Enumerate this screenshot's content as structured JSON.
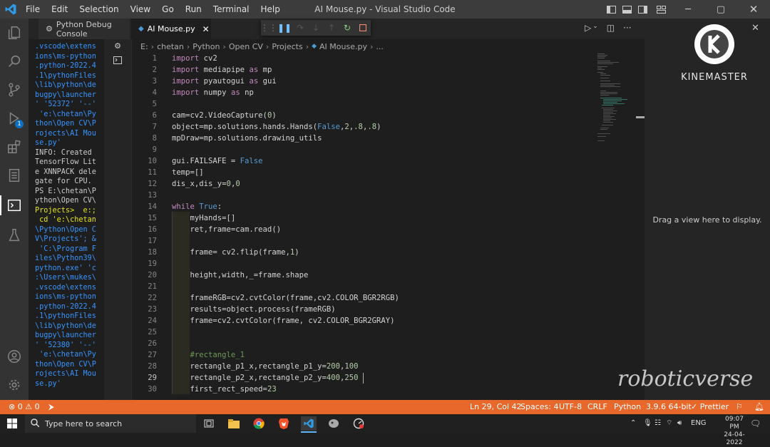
{
  "window": {
    "title": "AI Mouse.py - Visual Studio Code",
    "minimize": "─",
    "maximize": "▢",
    "close": "✕"
  },
  "menu": [
    "File",
    "Edit",
    "Selection",
    "View",
    "Go",
    "Run",
    "Terminal",
    "Help"
  ],
  "tabs": [
    {
      "label": "Python Debug Console",
      "icon": "gear-icon"
    },
    {
      "label": "AI Mouse.py",
      "icon": "python-file-icon",
      "close": "✕"
    }
  ],
  "debug_toolbar": [
    "drag-handle-icon",
    "pause-icon",
    "step-over-icon",
    "step-into-icon",
    "step-out-icon",
    "restart-icon",
    "stop-icon"
  ],
  "breadcrumb": [
    "E:",
    "chetan",
    "Python",
    "Open CV",
    "Projects",
    "AI Mouse.py",
    "..."
  ],
  "terminal": {
    "lines": [
      {
        "t": ".vscode\\extens",
        "c": "b"
      },
      {
        "t": "ions\\ms-python",
        "c": "b"
      },
      {
        "t": ".python-2022.4",
        "c": "b"
      },
      {
        "t": ".1\\pythonFiles",
        "c": "b"
      },
      {
        "t": "\\lib\\python\\de",
        "c": "b"
      },
      {
        "t": "bugpy\\launcher",
        "c": "b"
      },
      {
        "t": "' '52372' '--'",
        "c": "b"
      },
      {
        "t": " 'e:\\chetan\\Py",
        "c": "b"
      },
      {
        "t": "thon\\Open CV\\P",
        "c": "b"
      },
      {
        "t": "rojects\\AI Mou",
        "c": "b"
      },
      {
        "t": "se.py'",
        "c": "b"
      },
      {
        "t": "INFO: Created",
        "c": "w"
      },
      {
        "t": "TensorFlow Lit",
        "c": "w"
      },
      {
        "t": "e XNNPACK dele",
        "c": "w"
      },
      {
        "t": "gate for CPU.",
        "c": "w"
      },
      {
        "t": "PS E:\\chetan\\P",
        "c": "w"
      },
      {
        "t": "ython\\Open CV\\",
        "c": "w"
      },
      {
        "t": "Projects>  e:;",
        "c": "y"
      },
      {
        "t": " cd 'e:\\chetan",
        "c": "y"
      },
      {
        "t": "\\Python\\Open C",
        "c": "b"
      },
      {
        "t": "V\\Projects'; &",
        "c": "b"
      },
      {
        "t": " 'C:\\Program F",
        "c": "b"
      },
      {
        "t": "iles\\Python39\\",
        "c": "b"
      },
      {
        "t": "python.exe' 'c",
        "c": "b"
      },
      {
        "t": ":\\Users\\mukes\\",
        "c": "b"
      },
      {
        "t": ".vscode\\extens",
        "c": "b"
      },
      {
        "t": "ions\\ms-python",
        "c": "b"
      },
      {
        "t": ".python-2022.4",
        "c": "b"
      },
      {
        "t": ".1\\pythonFiles",
        "c": "b"
      },
      {
        "t": "\\lib\\python\\de",
        "c": "b"
      },
      {
        "t": "bugpy\\launcher",
        "c": "b"
      },
      {
        "t": "' '52380' '--'",
        "c": "b"
      },
      {
        "t": " 'e:\\chetan\\Py",
        "c": "b"
      },
      {
        "t": "thon\\Open CV\\P",
        "c": "b"
      },
      {
        "t": "rojects\\AI Mou",
        "c": "b"
      },
      {
        "t": "se.py'",
        "c": "b"
      }
    ]
  },
  "code": {
    "current_line": 29,
    "lines": [
      {
        "n": "1",
        "html": "<span class='kw'>import</span> cv2"
      },
      {
        "n": "2",
        "html": "<span class='kw'>import</span> mediapipe <span class='kw'>as</span> mp"
      },
      {
        "n": "3",
        "html": "<span class='kw'>import</span> pyautogui <span class='kw'>as</span> gui"
      },
      {
        "n": "4",
        "html": "<span class='kw'>import</span> numpy <span class='kw'>as</span> np"
      },
      {
        "n": "5",
        "html": ""
      },
      {
        "n": "6",
        "html": "cam=cv2.VideoCapture(<span class='nm'>0</span>)"
      },
      {
        "n": "7",
        "html": "object=mp.solutions.hands.Hands(<span class='kb'>False</span>,<span class='nm'>2</span>,<span class='nm'>.8</span>,<span class='nm'>.8</span>)"
      },
      {
        "n": "8",
        "html": "mpDraw=mp.solutions.drawing_utils"
      },
      {
        "n": "9",
        "html": ""
      },
      {
        "n": "10",
        "html": "gui.FAILSAFE = <span class='kb'>False</span>"
      },
      {
        "n": "11",
        "html": "temp=[]"
      },
      {
        "n": "12",
        "html": "dis_x,dis_y=<span class='nm'>0</span>,<span class='nm'>0</span>"
      },
      {
        "n": "13",
        "html": ""
      },
      {
        "n": "14",
        "html": "<span class='kw'>while</span> <span class='kb'>True</span>:"
      },
      {
        "n": "15",
        "html": "    myHands=[]"
      },
      {
        "n": "16",
        "html": "    ret,frame=cam.read()"
      },
      {
        "n": "17",
        "html": ""
      },
      {
        "n": "18",
        "html": "    frame= cv2.flip(frame,<span class='nm'>1</span>)"
      },
      {
        "n": "19",
        "html": ""
      },
      {
        "n": "20",
        "html": "    height,width,_=frame.shape"
      },
      {
        "n": "21",
        "html": ""
      },
      {
        "n": "22",
        "html": "    frameRGB=cv2.cvtColor(frame,cv2.COLOR_BGR2RGB)"
      },
      {
        "n": "23",
        "html": "    results=object.process(frameRGB)"
      },
      {
        "n": "24",
        "html": "    frame=cv2.cvtColor(frame, cv2.COLOR_BGR2GRAY)"
      },
      {
        "n": "25",
        "html": ""
      },
      {
        "n": "26",
        "html": ""
      },
      {
        "n": "27",
        "html": "    <span class='cm'>#rectangle_1</span>"
      },
      {
        "n": "28",
        "html": "    rectangle_p1_x,rectangle_p1_y=<span class='nm'>200</span>,<span class='nm'>100</span>"
      },
      {
        "n": "29",
        "html": "    rectangle_p2_x,rectangle_p2_y=<span class='nm'>400</span>,<span class='nm'>250</span>"
      },
      {
        "n": "30",
        "html": "    first_rect_speed=<span class='nm'>23</span>"
      }
    ]
  },
  "right_panel": {
    "logo_text": "KINEMASTER",
    "drag_text": "Drag a view here to display.",
    "close": "✕"
  },
  "watermark": "roboticverse",
  "status": {
    "errors": "0",
    "warnings": "0",
    "position": "Ln 29, Col 42",
    "spaces": "Spaces: 4",
    "encoding": "UTF-8",
    "eol": "CRLF",
    "language": "Python",
    "interpreter": "3.9.6 64-bit",
    "formatter": "Prettier"
  },
  "taskbar": {
    "search_placeholder": "Type here to search",
    "lang": "ENG",
    "time": "09:07 PM",
    "date": "24-04-2022"
  },
  "colors": {
    "status_bar": "#e8682b",
    "accent": "#0e70c0"
  }
}
